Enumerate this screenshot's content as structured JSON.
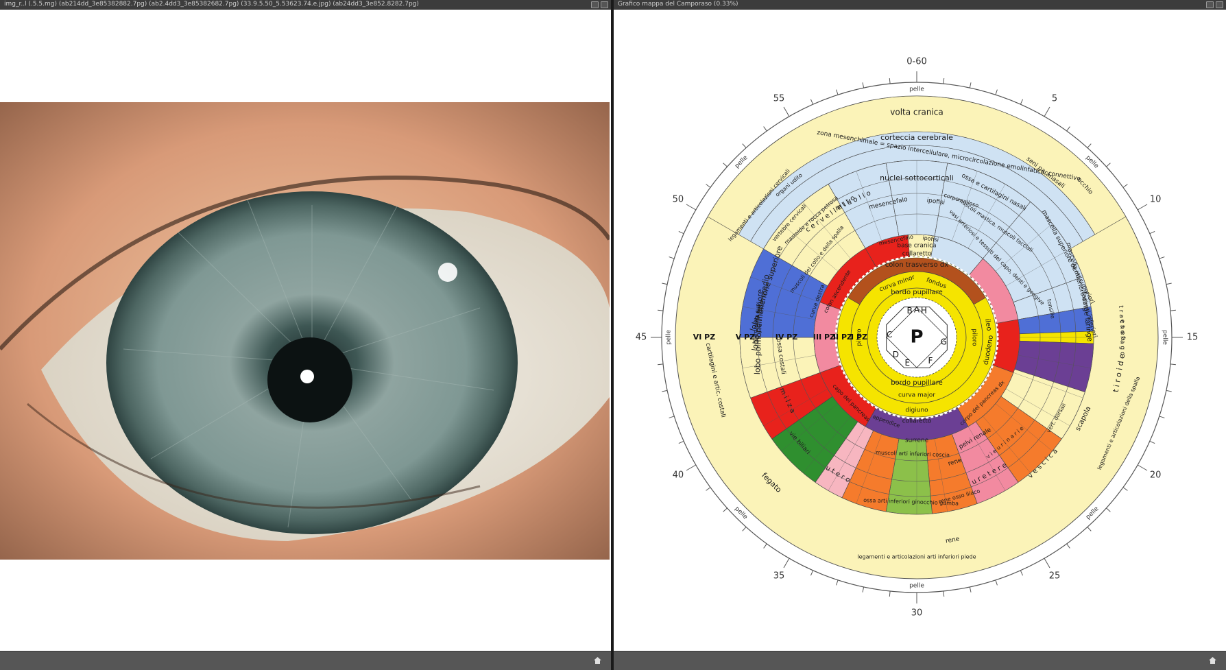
{
  "left_window": {
    "title": "img_r..l (.5.5.mg) (ab214dd_3e85382882.7pg) (ab2.4dd3_3e85382682.7pg) (33.9.5.50_5.53623.74.e.jpg) (ab24dd3_3e852.8282.7pg)",
    "status_icon": "home-icon"
  },
  "right_window": {
    "title": "Grafico mappa del Camporaso (0.33%)",
    "status_icon": "home-icon"
  },
  "iris_map": {
    "clock_labels": [
      "0-60",
      "5",
      "10",
      "15",
      "20",
      "25",
      "30",
      "35",
      "40",
      "45",
      "50",
      "55"
    ],
    "pelle": "pelle",
    "center": "P",
    "center_letters": [
      "B",
      "A",
      "H",
      "G",
      "F",
      "E",
      "D",
      "C"
    ],
    "zones": [
      "I PZ",
      "II PZ",
      "III PZ",
      "IV PZ",
      "V PZ",
      "VI PZ"
    ],
    "ring_labels": {
      "volta": "volta cranica",
      "corteccia": "corteccia cerebrale",
      "mesenchimale": "zona mesenchimale = spazio intercellulare, microcircolazione emolinfatica, connettivo",
      "nuclei": "nuclei sottocorticali",
      "collaretto_top": "collaretto",
      "collaretto_bottom": "collaretto",
      "colon": "colon trasverso dx",
      "bordo_top": "bordo pupillare",
      "bordo_bottom": "bordo pupillare",
      "curva_minor": "curva minor",
      "curva_major": "curva major",
      "digiuno": "digiuno",
      "ileo": "ileo",
      "duodeno": "duodeno",
      "piloro_l": "piloro",
      "piloro_r": "piloro",
      "base_cranica": "base cranica",
      "fondus": "fondus"
    },
    "organs": {
      "mesencefalo": "mesencefalo",
      "mesencefalo2": "mesencefalo",
      "ipofisi": "ipofisi",
      "ipofisi2": "ipofisi",
      "corpo_calloso": "corpo calloso",
      "seni": "seni paranasali",
      "occhio": "occhio",
      "ossa_cart": "ossa e cartilagini nasali",
      "muscoli_facciali": "muscoli mastica. muscoli facciali",
      "vasi": "vasi arteriosi e tessuti del capo, denti e gengive",
      "mascella_sup": "mascella superiore denti superiori",
      "mascella_inf": "mascella inferiore denti inferiori",
      "tonsille": "tonsille",
      "faringe": "faringe laringe",
      "esofago": "e s o f a g o",
      "trachea": "t r a c h e a",
      "tiroide": "t i r o i d e",
      "scapola": "scapola",
      "lobo_sup": "lobo polmone superiore",
      "lobo_medio": "lobo polmone medio",
      "lobo_inf": "lobo polmone inferiore",
      "mammella": "mammella sup",
      "ossa_costali": "ossa costali",
      "cartilagini": "cartilagini e artic. costali",
      "fegato": "fegato",
      "vie_biliari": "vie biliari",
      "rene": "rene",
      "rene2": "rene",
      "rene_osso": "rene osso iliaco",
      "pelvi": "pelvi renale",
      "surrene": "surrene",
      "musc_arti": "muscoli arti inferiori coscia",
      "ossa_arti": "ossa arti inferiori ginocchio gamba",
      "legamenti_piede": "legamenti e articolazioni arti inferiori piede",
      "vescica": "v e s c i c a",
      "uretere": "u r e t e r e",
      "utero": "u t e r o",
      "vie_urinarie": "v i e   u r i n a r i e",
      "milza": "m i l z a",
      "cervelletto": "c e r v e l l e t t o",
      "midollo": "m i d o l l o",
      "vertebre": "vertebre cervicali",
      "mastoide": "mastoide e rocca petrosa",
      "organi_udito": "organi udito",
      "legamenti_cerv": "legamenti e articolazioni cervicali",
      "musc_collo": "muscoli del collo e della spalla",
      "curva_destra": "curva destra",
      "colon_asc": "colon ascendente",
      "capo_pancreas": "capo del pancreas",
      "corpo_pancreas": "corpo del pancreas dx",
      "appendice": "appendice",
      "vert_dorsali": "vert. dorsali",
      "legamenti_spalla": "legamenti e articolazioni della spalla"
    },
    "colors": {
      "yellow": "#f5e400",
      "cream": "#fbf3b8",
      "lightblue": "#cfe2f3",
      "blue": "#4f6fd6",
      "red": "#e8221c",
      "pink": "#f28aa0",
      "lightpink": "#f7b6c0",
      "orange": "#f57b2c",
      "green": "#2f8f2f",
      "lightgreen": "#8cc04a",
      "purple": "#6b3f94",
      "brown": "#b3511d"
    }
  }
}
